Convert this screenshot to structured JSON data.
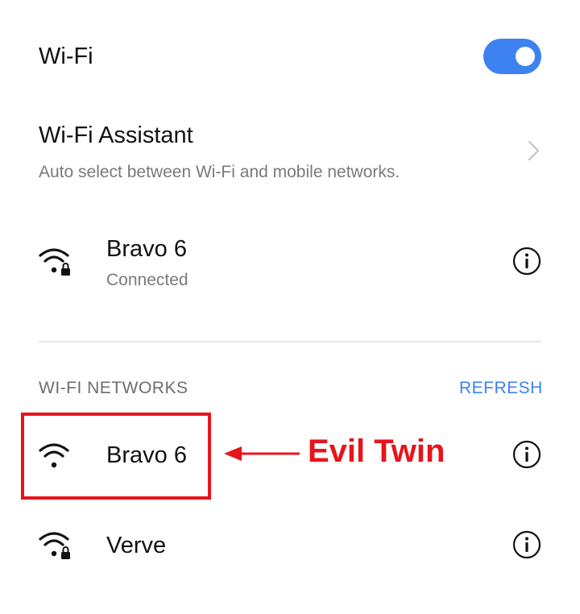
{
  "wifi_toggle": {
    "label": "Wi-Fi",
    "enabled": true
  },
  "assistant": {
    "title": "Wi-Fi Assistant",
    "subtitle": "Auto select between Wi-Fi and mobile networks."
  },
  "connected": {
    "name": "Bravo 6",
    "status": "Connected",
    "secured": true
  },
  "networks_section": {
    "title": "WI-FI NETWORKS",
    "refresh_label": "REFRESH"
  },
  "networks": [
    {
      "name": "Bravo 6",
      "secured": false
    },
    {
      "name": "Verve",
      "secured": true
    }
  ],
  "annotation": {
    "label": "Evil Twin",
    "color": "#e8141b"
  },
  "colors": {
    "accent": "#3d82f0",
    "annotation": "#e8141b"
  },
  "icons": [
    "wifi-lock-icon",
    "wifi-icon",
    "info-icon",
    "chevron-right-icon",
    "arrow-left-icon"
  ]
}
